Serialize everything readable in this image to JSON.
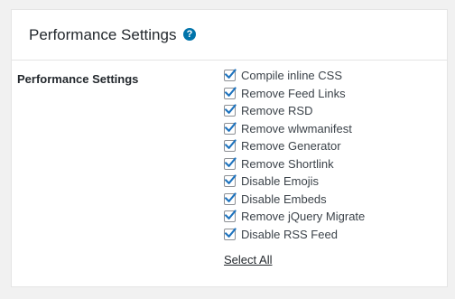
{
  "panel": {
    "title": "Performance Settings",
    "help_icon": "?"
  },
  "field": {
    "label": "Performance Settings",
    "options": [
      {
        "label": "Compile inline CSS",
        "checked": true
      },
      {
        "label": "Remove Feed Links",
        "checked": true
      },
      {
        "label": "Remove RSD",
        "checked": true
      },
      {
        "label": "Remove wlwmanifest",
        "checked": true
      },
      {
        "label": "Remove Generator",
        "checked": true
      },
      {
        "label": "Remove Shortlink",
        "checked": true
      },
      {
        "label": "Disable Emojis",
        "checked": true
      },
      {
        "label": "Disable Embeds",
        "checked": true
      },
      {
        "label": "Remove jQuery Migrate",
        "checked": true
      },
      {
        "label": "Disable RSS Feed",
        "checked": true
      }
    ],
    "select_all": "Select All"
  },
  "colors": {
    "accent": "#0073aa",
    "checkmark": "#1e73be"
  }
}
